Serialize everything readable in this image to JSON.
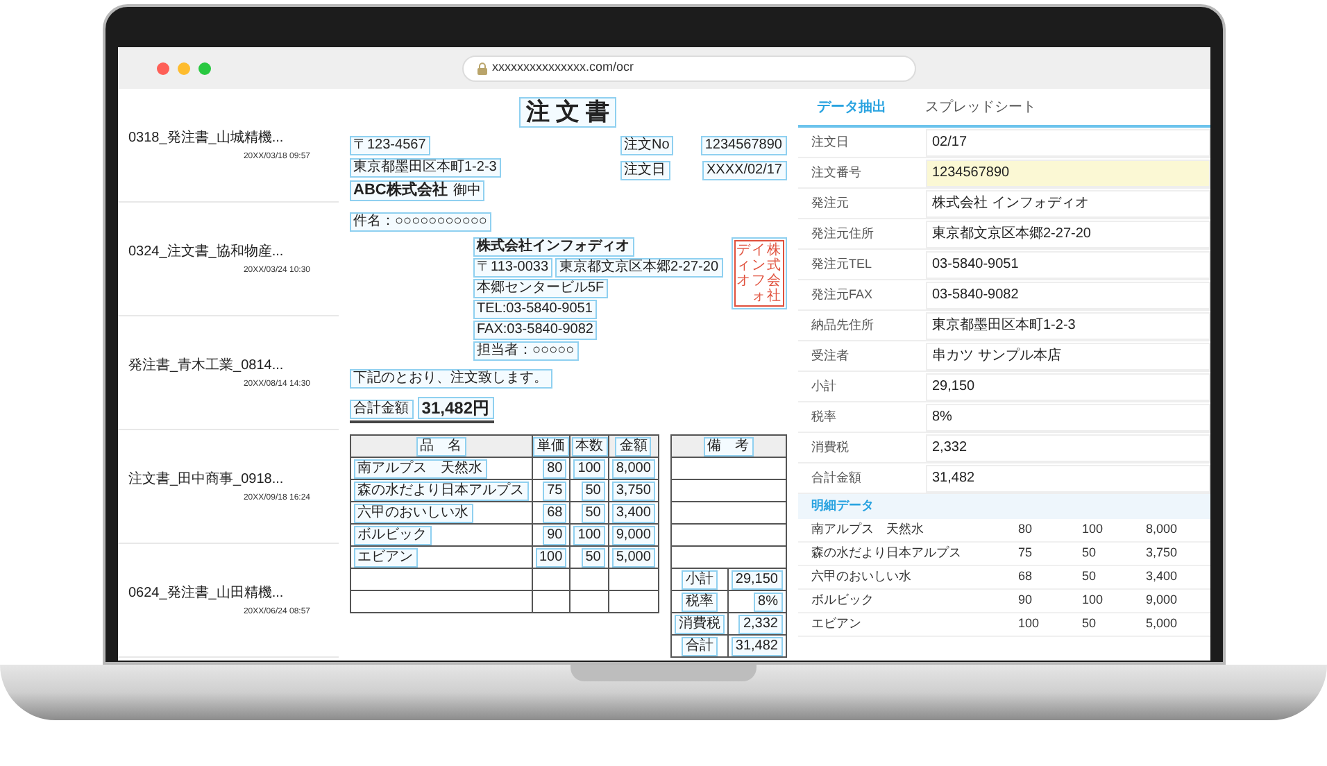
{
  "browser": {
    "url": "xxxxxxxxxxxxxxx.com/ocr"
  },
  "sidebar": {
    "items": [
      {
        "title": "0318_発注書_山城精機...",
        "date": "20XX/03/18 09:57"
      },
      {
        "title": "0324_注文書_協和物産...",
        "date": "20XX/03/24 10:30"
      },
      {
        "title": "発注書_青木工業_0814...",
        "date": "20XX/08/14 14:30"
      },
      {
        "title": "注文書_田中商事_0918...",
        "date": "20XX/09/18 16:24"
      },
      {
        "title": "0624_発注書_山田精機...",
        "date": "20XX/06/24 08:57"
      }
    ]
  },
  "document": {
    "title": "注 文 書",
    "recipient": {
      "postal": "〒123-4567",
      "address": "東京都墨田区本町1-2-3",
      "name": "ABC株式会社",
      "honorific": "御中"
    },
    "order_fields": [
      {
        "label": "注文No",
        "value": "1234567890"
      },
      {
        "label": "注文日",
        "value": "XXXX/02/17"
      }
    ],
    "subject": "件名：○○○○○○○○○○○",
    "sender": {
      "company": "株式会社インフォディオ",
      "postal": "〒113-0033",
      "address": "東京都文京区本郷2-27-20",
      "building": "本郷センタービル5F",
      "tel": "TEL:03-5840-9051",
      "fax": "FAX:03-5840-9082",
      "contact": "担当者：○○○○○"
    },
    "seal": [
      "ディオ",
      "インフォ",
      "株式会社"
    ],
    "message": "下記のとおり、注文致します。",
    "total": {
      "label": "合計金額",
      "value": "31,482円"
    },
    "items_table": {
      "columns": [
        "品　名",
        "単価",
        "本数",
        "金額"
      ],
      "rows": [
        [
          "南アルプス　天然水",
          "80",
          "100",
          "8,000"
        ],
        [
          "森の水だより日本アルプス",
          "75",
          "50",
          "3,750"
        ],
        [
          "六甲のおいしい水",
          "68",
          "50",
          "3,400"
        ],
        [
          "ボルビック",
          "90",
          "100",
          "9,000"
        ],
        [
          "エビアン",
          "100",
          "50",
          "5,000"
        ]
      ]
    },
    "remarks_header": "備　考",
    "summary": [
      {
        "label": "小計",
        "value": "29,150"
      },
      {
        "label": "税率",
        "value": "8%"
      },
      {
        "label": "消費税",
        "value": "2,332"
      },
      {
        "label": "合計",
        "value": "31,482"
      }
    ]
  },
  "panel": {
    "tabs": [
      {
        "label": "データ抽出",
        "selected": true
      },
      {
        "label": "スプレッドシート",
        "selected": false
      }
    ],
    "fields": [
      {
        "label": "注文日",
        "value": "02/17",
        "highlighted": false
      },
      {
        "label": "注文番号",
        "value": "1234567890",
        "highlighted": true
      },
      {
        "label": "発注元",
        "value": "株式会社 インフォディオ",
        "highlighted": false
      },
      {
        "label": "発注元住所",
        "value": "東京都文京区本郷2-27-20",
        "highlighted": false
      },
      {
        "label": "発注元TEL",
        "value": "03-5840-9051",
        "highlighted": false
      },
      {
        "label": "発注元FAX",
        "value": "03-5840-9082",
        "highlighted": false
      },
      {
        "label": "納品先住所",
        "value": "東京都墨田区本町1-2-3",
        "highlighted": false
      },
      {
        "label": "受注者",
        "value": "串カツ サンプル本店",
        "highlighted": false
      },
      {
        "label": "小計",
        "value": "29,150",
        "highlighted": false
      },
      {
        "label": "税率",
        "value": "8%",
        "highlighted": false
      },
      {
        "label": "消費税",
        "value": "2,332",
        "highlighted": false
      },
      {
        "label": "合計金額",
        "value": "31,482",
        "highlighted": false
      }
    ],
    "details_title": "明細データ",
    "details": [
      [
        "南アルプス　天然水",
        "80",
        "100",
        "8,000"
      ],
      [
        "森の水だより日本アルプス",
        "75",
        "50",
        "3,750"
      ],
      [
        "六甲のおいしい水",
        "68",
        "50",
        "3,400"
      ],
      [
        "ボルビック",
        "90",
        "100",
        "9,000"
      ],
      [
        "エビアン",
        "100",
        "50",
        "5,000"
      ]
    ]
  }
}
